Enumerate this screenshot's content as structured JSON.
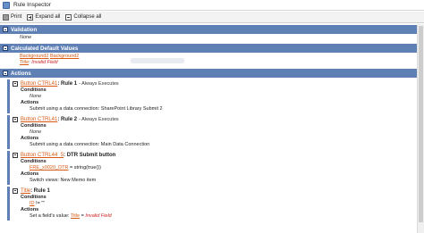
{
  "window": {
    "title": "Rule Inspector"
  },
  "toolbar": {
    "print": "Print",
    "expand_all": "Expand all",
    "collapse_all": "Collapse all"
  },
  "sections": {
    "validation": {
      "title": "Validation",
      "value": "None"
    },
    "calculated": {
      "title": "Calculated Default Values",
      "line1_link_a": "Background2",
      "line1_link_b": "Background2",
      "line2_link": "Title",
      "line2_sep": ":",
      "line2_value": "Invalid Field"
    },
    "actions": {
      "title": "Actions"
    }
  },
  "rules": [
    {
      "link": "Button CTRL41",
      "name": ": Rule 1",
      "suffix": "- Always Executes",
      "conditions_label": "Conditions",
      "conditions_value": "None",
      "actions_label": "Actions",
      "action_text": "Submit using a data connection: SharePoint Library Submit 2"
    },
    {
      "link": "Button CTRL41",
      "name": ": Rule 2",
      "suffix": "- Always Executes",
      "conditions_label": "Conditions",
      "conditions_value": "None",
      "actions_label": "Actions",
      "action_text": "Submit using a data connection: Main Data Connection"
    },
    {
      "link": "Button CTRL44_5",
      "name": ": DTR Submit button",
      "conditions_label": "Conditions",
      "cond_link": "FRE_x0020_DTR",
      "cond_rest": " = string(true())",
      "actions_label": "Actions",
      "action_text": "Switch views: New Memo item"
    },
    {
      "link": "Title",
      "name": ": Rule 1",
      "conditions_label": "Conditions",
      "cond_link": "ID",
      "cond_rest": " != \"\"",
      "actions_label": "Actions",
      "action_prefix": "Set a field's value: ",
      "action_link": "Title",
      "action_eq": " = ",
      "action_value": "Invalid Field"
    }
  ]
}
